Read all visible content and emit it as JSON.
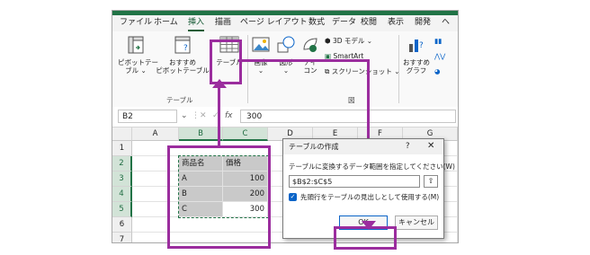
{
  "menu": {
    "tabs": [
      "ファイル",
      "ホーム",
      "挿入",
      "描画",
      "ページ レイアウト",
      "数式",
      "データ",
      "校閲",
      "表示",
      "開発",
      "ヘ"
    ],
    "active_tab": "挿入"
  },
  "ribbon": {
    "pivot_label_1": "ピボットテー",
    "pivot_label_2": "ブル ⌄",
    "recommended_pivot_label_1": "おすすめ",
    "recommended_pivot_label_2": "ピボットテーブル",
    "table_label": "テーブル",
    "group_table_label": "テーブル",
    "image_label": "画像",
    "shape_label": "図形",
    "icon_label_1": "アイ",
    "icon_label_2": "コン",
    "model_label": "3D モデル",
    "smartart_label": "SmartArt",
    "screenshot_label": "スクリーンショット",
    "group_figure_label": "図",
    "recommended_graph_label_1": "おすすめ",
    "recommended_graph_label_2": "グラフ"
  },
  "formula_bar": {
    "name_box": "B2",
    "fx": "fx",
    "value": "300"
  },
  "sheet": {
    "columns": [
      "A",
      "B",
      "C",
      "D",
      "E",
      "F",
      "G"
    ],
    "rows": [
      "1",
      "2",
      "3",
      "4",
      "5",
      "6",
      "7"
    ],
    "cells": {
      "B2": "商品名",
      "C2": "価格",
      "B3": "A",
      "C3": "100",
      "B4": "B",
      "C4": "200",
      "B5": "C",
      "C5": "300"
    }
  },
  "dialog": {
    "title": "テーブルの作成",
    "help": "?",
    "close": "✕",
    "range_label": "テーブルに変換するデータ範囲を指定してください(W)",
    "range_value": "$B$2:$C$5",
    "range_button": "⇧",
    "checkbox_checked": true,
    "checkbox_label": "先頭行をテーブルの見出しとして使用する(M)",
    "ok_label": "OK",
    "cancel_label": "キャンセル"
  },
  "colors": {
    "accent_green": "#217346",
    "callout_purple": "#9b2d9e",
    "dialog_blue": "#0a64c8"
  }
}
